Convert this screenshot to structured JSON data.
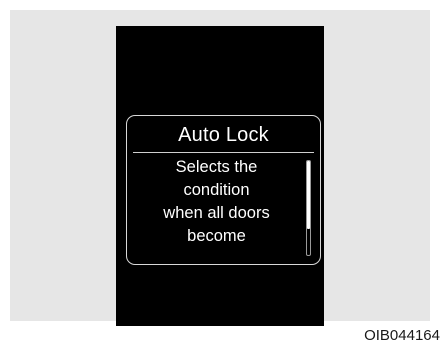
{
  "popup": {
    "title": "Auto Lock",
    "body_lines": [
      "Selects the",
      "condition",
      "when all doors",
      "become"
    ],
    "scroll_position": 0.0
  },
  "image_code": "OIB044164",
  "colors": {
    "background": "#e6e6e6",
    "display": "#000000",
    "text": "#ffffff",
    "border": "#d8d8d8"
  }
}
